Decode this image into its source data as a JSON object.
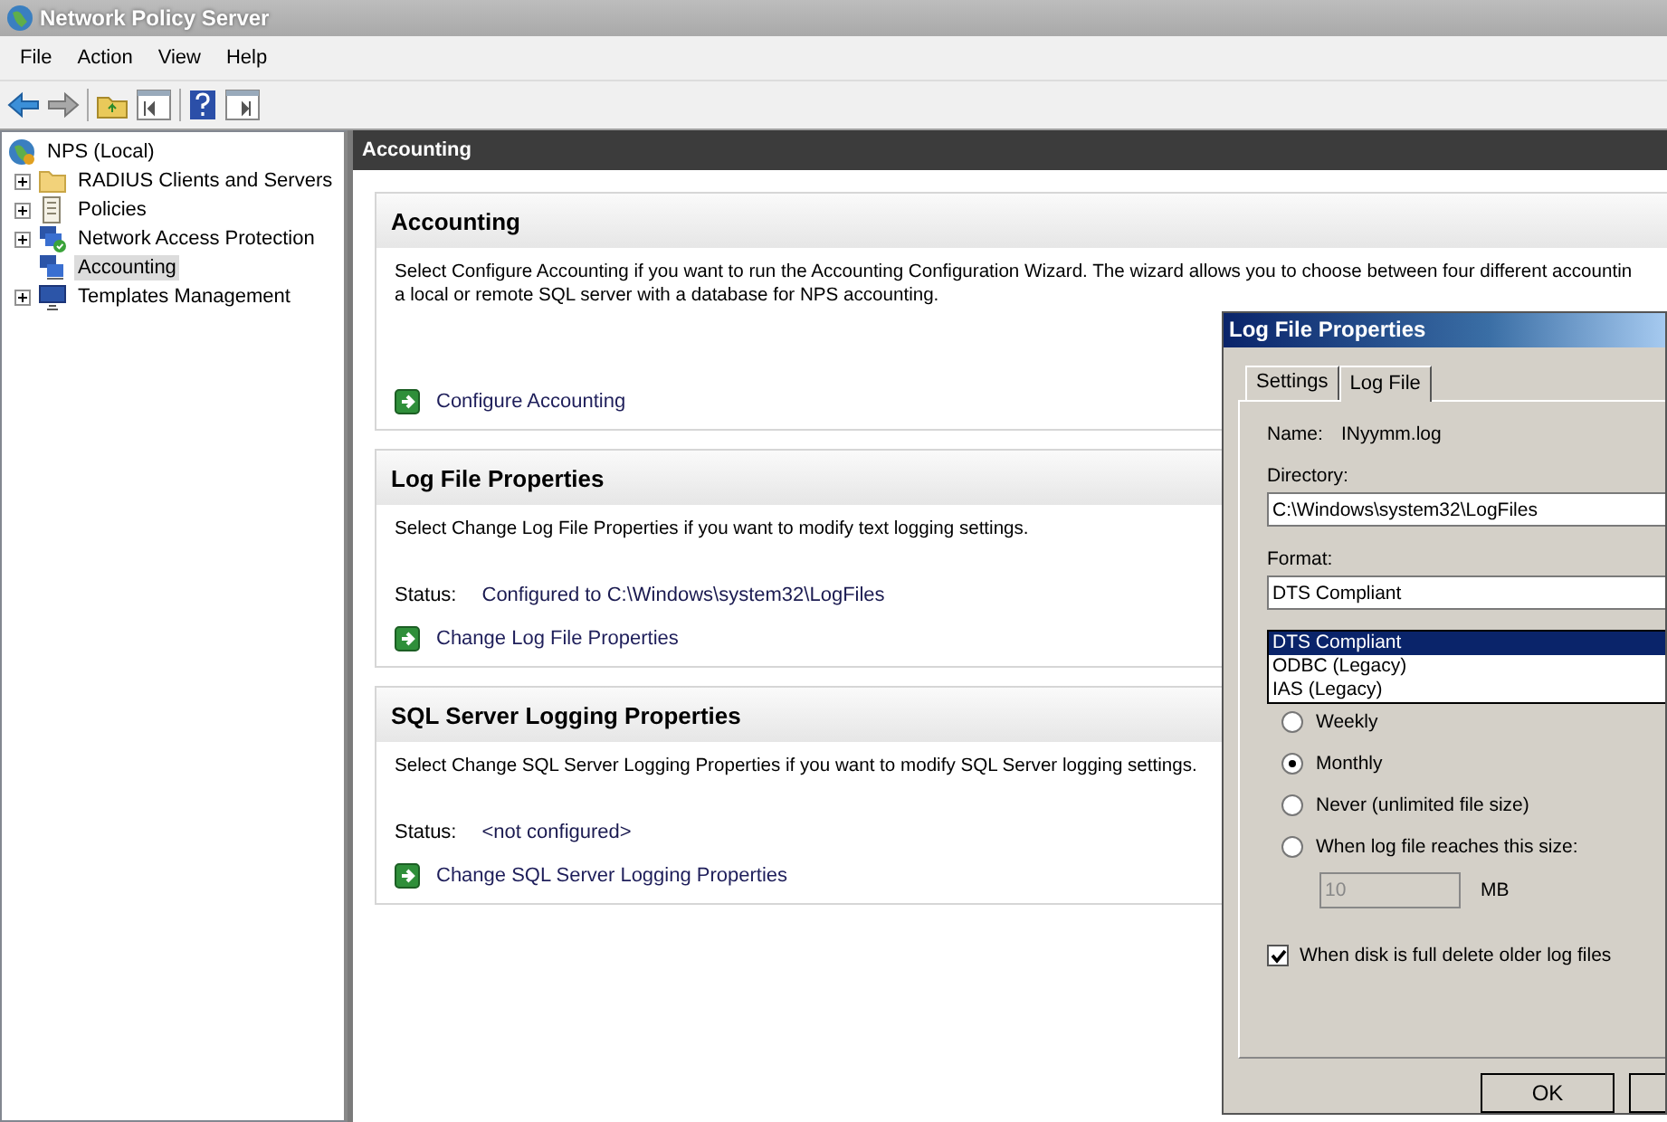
{
  "window": {
    "title": "Network Policy Server"
  },
  "menu": [
    "File",
    "Action",
    "View",
    "Help"
  ],
  "tree": {
    "items": [
      {
        "label": "NPS (Local)",
        "selected": false,
        "children": [
          {
            "label": "RADIUS Clients and Servers",
            "expanded": false,
            "selected": false
          },
          {
            "label": "Policies",
            "expanded": false,
            "selected": false
          },
          {
            "label": "Network Access Protection",
            "expanded": false,
            "selected": false
          },
          {
            "label": "Accounting",
            "selected": true
          },
          {
            "label": "Templates Management",
            "expanded": false,
            "selected": false
          }
        ]
      }
    ]
  },
  "pane": {
    "title": "Accounting",
    "sections": [
      {
        "title": "Accounting",
        "description_lines": [
          "Select Configure Accounting if you want to run the Accounting Configuration Wizard. The wizard allows you to choose between four different accountin",
          "a local or remote SQL server with a database for NPS accounting."
        ],
        "link": "Configure Accounting"
      },
      {
        "title": "Log File Properties",
        "description_lines": [
          "Select Change Log File Properties if you want to modify text logging settings."
        ],
        "status_label": "Status:",
        "status_value": "Configured to C:\\Windows\\system32\\LogFiles",
        "link": "Change Log File Properties"
      },
      {
        "title": "SQL Server Logging Properties",
        "description_lines": [
          "Select Change SQL Server Logging Properties if you want to modify SQL Server logging settings."
        ],
        "status_label": "Status:",
        "status_value": "<not configured>",
        "link": "Change SQL Server Logging Properties"
      }
    ]
  },
  "dialog": {
    "title": "Log File Properties",
    "tabs": [
      {
        "label": "Settings",
        "selected": false
      },
      {
        "label": "Log File",
        "selected": true
      }
    ],
    "name_label": "Name:",
    "name_value": "INyymm.log",
    "directory_label": "Directory:",
    "directory_value": "C:\\Windows\\system32\\LogFiles",
    "format_label": "Format:",
    "format_value": "DTS Compliant",
    "format_options": [
      {
        "label": "DTS Compliant",
        "selected": true
      },
      {
        "label": "ODBC (Legacy)",
        "selected": false
      },
      {
        "label": "IAS (Legacy)",
        "selected": false
      }
    ],
    "radios": [
      {
        "label": "Weekly",
        "selected": false
      },
      {
        "label": "Monthly",
        "selected": true
      },
      {
        "label": "Never (unlimited file size)",
        "selected": false
      },
      {
        "label": "When log file reaches this size:",
        "selected": false
      }
    ],
    "size_value": "10",
    "size_disabled": true,
    "size_unit": "MB",
    "delete_old": {
      "label": "When disk is full delete older log files",
      "checked": true
    },
    "buttons": [
      "OK"
    ]
  }
}
